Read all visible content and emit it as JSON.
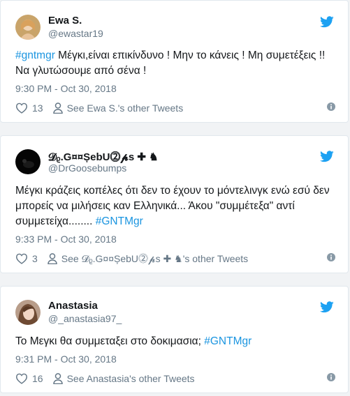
{
  "tweets": [
    {
      "name": "Ewa S.",
      "handle": "@ewastar19",
      "text_parts": [
        "#gntmgr",
        " Μέγκι,είναι επικίνδυνο ! Μην το κάνεις ! Μη συμετέξεις !! Να γλυτώσουμε από σένα !"
      ],
      "time": "9:30 PM - Oct 30, 2018",
      "likes": "13",
      "other_tweets": "See Ewa S.'s other Tweets"
    },
    {
      "name": "𝓓ᵨ.G¤¤ȘebU⓶𝓹ѕ ✚ ♞",
      "handle": "@DrGoosebumps",
      "text_parts": [
        "Μέγκι κράζεις κοπέλες ότι δεν το έχουν το μόντελινγκ ενώ εσύ δεν μπορείς να μιλήσεις καν Ελληνικά... Άκου \"συμμέτεξα\" αντί συμμετείχα........ ",
        "#GNTMgr"
      ],
      "time": "9:33 PM - Oct 30, 2018",
      "likes": "3",
      "other_tweets": "See 𝓓ᵨ.G¤¤ȘebU⓶𝓹ѕ ✚ ♞'s other Tweets"
    },
    {
      "name": "Anastasia",
      "handle": "@_anastasia97_",
      "text_parts": [
        "Το Μεγκι θα συμμεταξει στο δοκιμασια; ",
        "#GNTMgr"
      ],
      "time": "9:31 PM - Oct 30, 2018",
      "likes": "16",
      "other_tweets": "See Anastasia's other Tweets"
    }
  ],
  "colors": {
    "link": "#1b95e0",
    "muted": "#657786",
    "bird": "#1da1f2"
  }
}
